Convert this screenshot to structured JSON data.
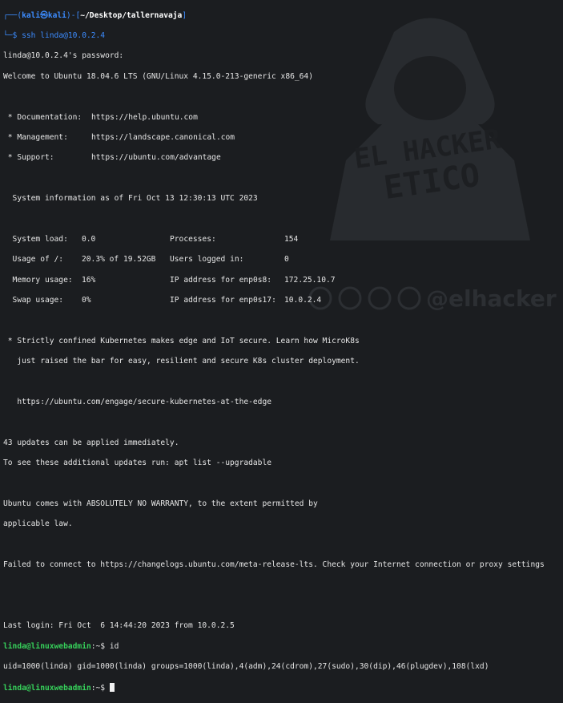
{
  "prompt1": {
    "user": "kali",
    "host": "kali",
    "path": "~/Desktop/tallernavaja",
    "command": "ssh linda@10.0.2.4"
  },
  "password_prompt": "linda@10.0.2.4's password:",
  "welcome": "Welcome to Ubuntu 18.04.6 LTS (GNU/Linux 4.15.0-213-generic x86_64)",
  "links": [
    {
      "label": " * Documentation:",
      "url": "https://help.ubuntu.com"
    },
    {
      "label": " * Management:",
      "url": "https://landscape.canonical.com"
    },
    {
      "label": " * Support:",
      "url": "https://ubuntu.com/advantage"
    }
  ],
  "sysinfo_header": "  System information as of Fri Oct 13 12:30:13 UTC 2023",
  "sysinfo": [
    {
      "k1": "  System load:",
      "v1": "0.0",
      "k2": "Processes:",
      "v2": "154"
    },
    {
      "k1": "  Usage of /:",
      "v1": "20.3% of 19.52GB",
      "k2": "Users logged in:",
      "v2": "0"
    },
    {
      "k1": "  Memory usage:",
      "v1": "16%",
      "k2": "IP address for enp0s8:",
      "v2": "172.25.10.7"
    },
    {
      "k1": "  Swap usage:",
      "v1": "0%",
      "k2": "IP address for enp0s17:",
      "v2": "10.0.2.4"
    }
  ],
  "k8s": [
    " * Strictly confined Kubernetes makes edge and IoT secure. Learn how MicroK8s",
    "   just raised the bar for easy, resilient and secure K8s cluster deployment."
  ],
  "k8s_url": "   https://ubuntu.com/engage/secure-kubernetes-at-the-edge",
  "updates": [
    "43 updates can be applied immediately.",
    "To see these additional updates run: apt list --upgradable"
  ],
  "warranty": [
    "Ubuntu comes with ABSOLUTELY NO WARRANTY, to the extent permitted by",
    "applicable law."
  ],
  "failed": "Failed to connect to https://changelogs.ubuntu.com/meta-release-lts. Check your Internet connection or proxy settings",
  "last_login": "Last login: Fri Oct  6 14:44:20 2023 from 10.0.2.5",
  "prompt2": {
    "user_host": "linda@linuxwebadmin",
    "tail": ":~$ ",
    "command": "id"
  },
  "id_output": "uid=1000(linda) gid=1000(linda) groups=1000(linda),4(adm),24(cdrom),27(sudo),30(dip),46(plugdev),108(lxd)",
  "prompt3": {
    "user_host": "linda@linuxwebadmin",
    "tail": ":~$ "
  },
  "watermark": {
    "line1": "EL HACKER",
    "line2": "ETICO",
    "handle": "@elhacker"
  },
  "colors": {
    "background": "#1b1d20",
    "prompt_blue": "#3c8cff",
    "user_green": "#36d05a"
  }
}
